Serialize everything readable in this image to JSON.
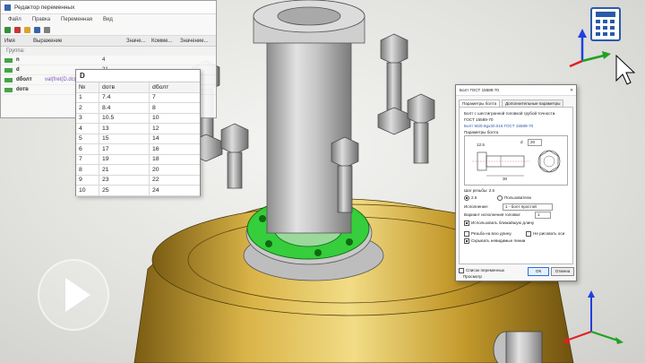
{
  "variables_window": {
    "title": "Редактор переменных",
    "menu": [
      "Файл",
      "Правка",
      "Переменная",
      "Вид"
    ],
    "columns": [
      "Имя",
      "Выражение",
      "Значе...",
      "Коммe...",
      "Значение..."
    ],
    "group_label": "Группа:",
    "rows": [
      {
        "name": "n",
        "expression": "",
        "value": "4"
      },
      {
        "name": "d",
        "expression": "",
        "value": "21"
      },
      {
        "name": "dболт",
        "expression": "val(fret(D.dc(n)))",
        "value": ""
      },
      {
        "name": "dотв",
        "expression": "",
        "value": "200"
      }
    ]
  },
  "d_table": {
    "title": "D",
    "headers": [
      "№",
      "dотв",
      "dболт"
    ],
    "rows": [
      [
        "1",
        "7.4",
        "7"
      ],
      [
        "2",
        "8.4",
        "8"
      ],
      [
        "3",
        "10.5",
        "10"
      ],
      [
        "4",
        "13",
        "12"
      ],
      [
        "5",
        "15",
        "14"
      ],
      [
        "6",
        "17",
        "16"
      ],
      [
        "7",
        "19",
        "18"
      ],
      [
        "8",
        "21",
        "20"
      ],
      [
        "9",
        "23",
        "22"
      ],
      [
        "10",
        "25",
        "24"
      ]
    ]
  },
  "bolt_dialog": {
    "title": "Болт ГОСТ 15589-70",
    "close": "✕",
    "tabs": [
      "Параметры болта",
      "Дополнительные параметры"
    ],
    "description": "Болт с шестигранной головкой грубой точности.",
    "standard": "ГОСТ 15589-70",
    "designation": "Болт М20-6gх30.016 ГОСТ 15589-70",
    "section": "Параметры болта",
    "dim_d": "d",
    "dim_d_value": "20",
    "dim_l": "30",
    "dim_k": "12.5",
    "pitch_label": "Шаг резьбы: 2.5",
    "pitch_option": "2.5",
    "custom_option": "Пользователи",
    "execution_label": "Исполнение:",
    "execution_value": "1 - болт простой",
    "head_variant_label": "Вариант исполнения головки:",
    "head_variant_value": "1",
    "use_nearest": "Использовать ближайшую длину",
    "thread_full": "Резьба на всю длину",
    "no_axes": "Не рисовать оси",
    "hide_lines": "Скрывать невидимые линии",
    "var_list": "Список переменных",
    "preview": "Просмотр",
    "ok": "ОК",
    "cancel": "Отмена"
  },
  "colors": {
    "tank": "#c9a43c",
    "flange_highlight": "#35d23c",
    "metal": "#b8b8b8",
    "axis_x": "#e02020",
    "axis_y": "#20a020",
    "axis_z": "#2040e0"
  },
  "icons": {
    "play": "play-icon",
    "calculator": "variables-calculator-icon",
    "cursor": "cursor-icon"
  }
}
